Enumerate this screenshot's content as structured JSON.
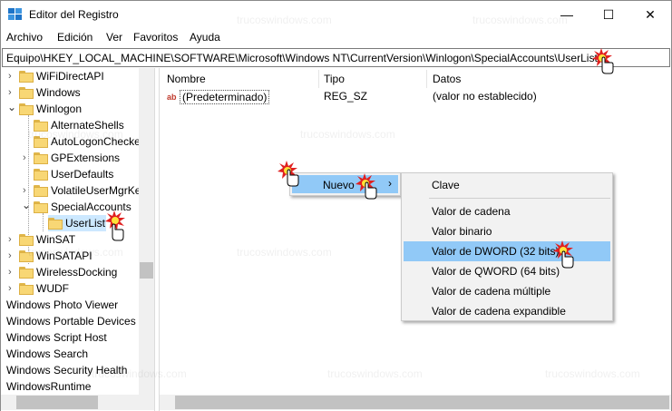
{
  "window": {
    "title": "Editor del Registro",
    "controls": {
      "minimize": "—",
      "maximize": "☐",
      "close": "✕"
    }
  },
  "menubar": [
    "Archivo",
    "Edición",
    "Ver",
    "Favoritos",
    "Ayuda"
  ],
  "address": "Equipo\\HKEY_LOCAL_MACHINE\\SOFTWARE\\Microsoft\\Windows NT\\CurrentVersion\\Winlogon\\SpecialAccounts\\UserList",
  "tree": {
    "items": [
      {
        "label": "WiFiDirectAPI",
        "expander": "›"
      },
      {
        "label": "Windows",
        "expander": "›"
      },
      {
        "label": "Winlogon",
        "expander": "⌄"
      },
      {
        "label": "AlternateShells",
        "expander": ""
      },
      {
        "label": "AutoLogonChecke",
        "expander": ""
      },
      {
        "label": "GPExtensions",
        "expander": "›"
      },
      {
        "label": "UserDefaults",
        "expander": ""
      },
      {
        "label": "VolatileUserMgrKe",
        "expander": "›"
      },
      {
        "label": "SpecialAccounts",
        "expander": "⌄"
      },
      {
        "label": "UserList",
        "expander": "",
        "selected": true
      },
      {
        "label": "WinSAT",
        "expander": "›"
      },
      {
        "label": "WinSATAPI",
        "expander": "›"
      },
      {
        "label": "WirelessDocking",
        "expander": "›"
      },
      {
        "label": "WUDF",
        "expander": "›"
      }
    ],
    "root_items": [
      "Windows Photo Viewer",
      "Windows Portable Devices",
      "Windows Script Host",
      "Windows Search",
      "Windows Security Health",
      "WindowsRuntime"
    ]
  },
  "list": {
    "columns": [
      "Nombre",
      "Tipo",
      "Datos"
    ],
    "rows": [
      {
        "icon": "ab",
        "name": "(Predeterminado)",
        "type": "REG_SZ",
        "data": "(valor no establecido)"
      }
    ]
  },
  "context_menu": {
    "nuevo_label": "Nuevo",
    "submenu_arrow": "›",
    "submenu": {
      "top": "Clave",
      "items": [
        "Valor de cadena",
        "Valor binario",
        "Valor de DWORD (32 bits)",
        "Valor de QWORD (64 bits)",
        "Valor de cadena múltiple",
        "Valor de cadena expandible"
      ],
      "highlighted_index": 2
    }
  },
  "watermark": "trucoswindows.com",
  "colors": {
    "selection": "#cce8ff",
    "menu_highlight": "#91c9f7",
    "folder": "#f8d775",
    "burst_red": "#e02020",
    "burst_yellow": "#ffe23a"
  }
}
